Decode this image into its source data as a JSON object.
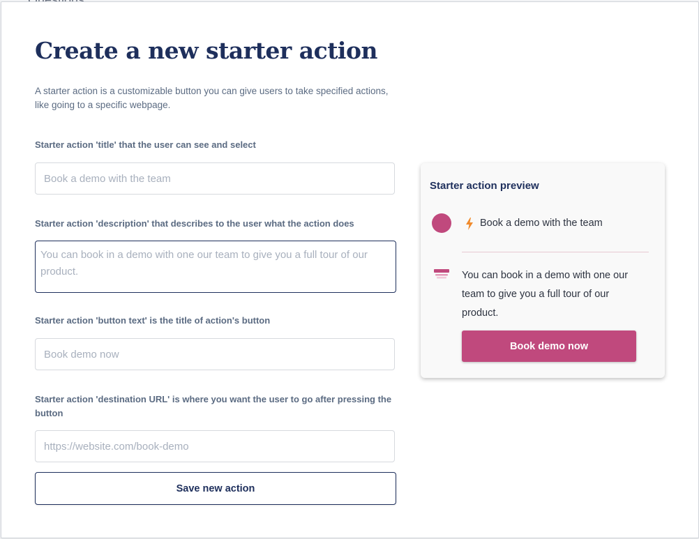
{
  "backdrop": {
    "text": "Questions"
  },
  "modal": {
    "title": "Create a new starter action",
    "intro": "A starter action is a customizable button you can give users to take specified actions, like going to a specific webpage."
  },
  "form": {
    "title_label": "Starter action 'title' that the user can see and select",
    "title_placeholder": "Book a demo with the team",
    "description_label": "Starter action 'description' that describes to the user what the action does",
    "description_placeholder": "You can book in a demo with one our team to give you a full tour of our product.",
    "button_text_label": "Starter action 'button text' is the title of action's button",
    "button_text_placeholder": "Book demo now",
    "url_label": "Starter action 'destination URL' is where you want the user to go after pressing the button",
    "url_placeholder": "https://website.com/book-demo",
    "save_label": "Save new action"
  },
  "preview": {
    "heading": "Starter action preview",
    "action_title": "Book a demo with the team",
    "description": "You can book in a demo with one our team to give you a full tour of our product.",
    "button_label": "Book demo now",
    "icons": [
      "avatar-dot",
      "lightning-bolt-icon",
      "description-icon"
    ]
  },
  "colors": {
    "brand_navy": "#1e2f5c",
    "accent_pink": "#c0497d",
    "bolt_orange": "#f08a2c",
    "muted_text": "#5b6b82"
  }
}
